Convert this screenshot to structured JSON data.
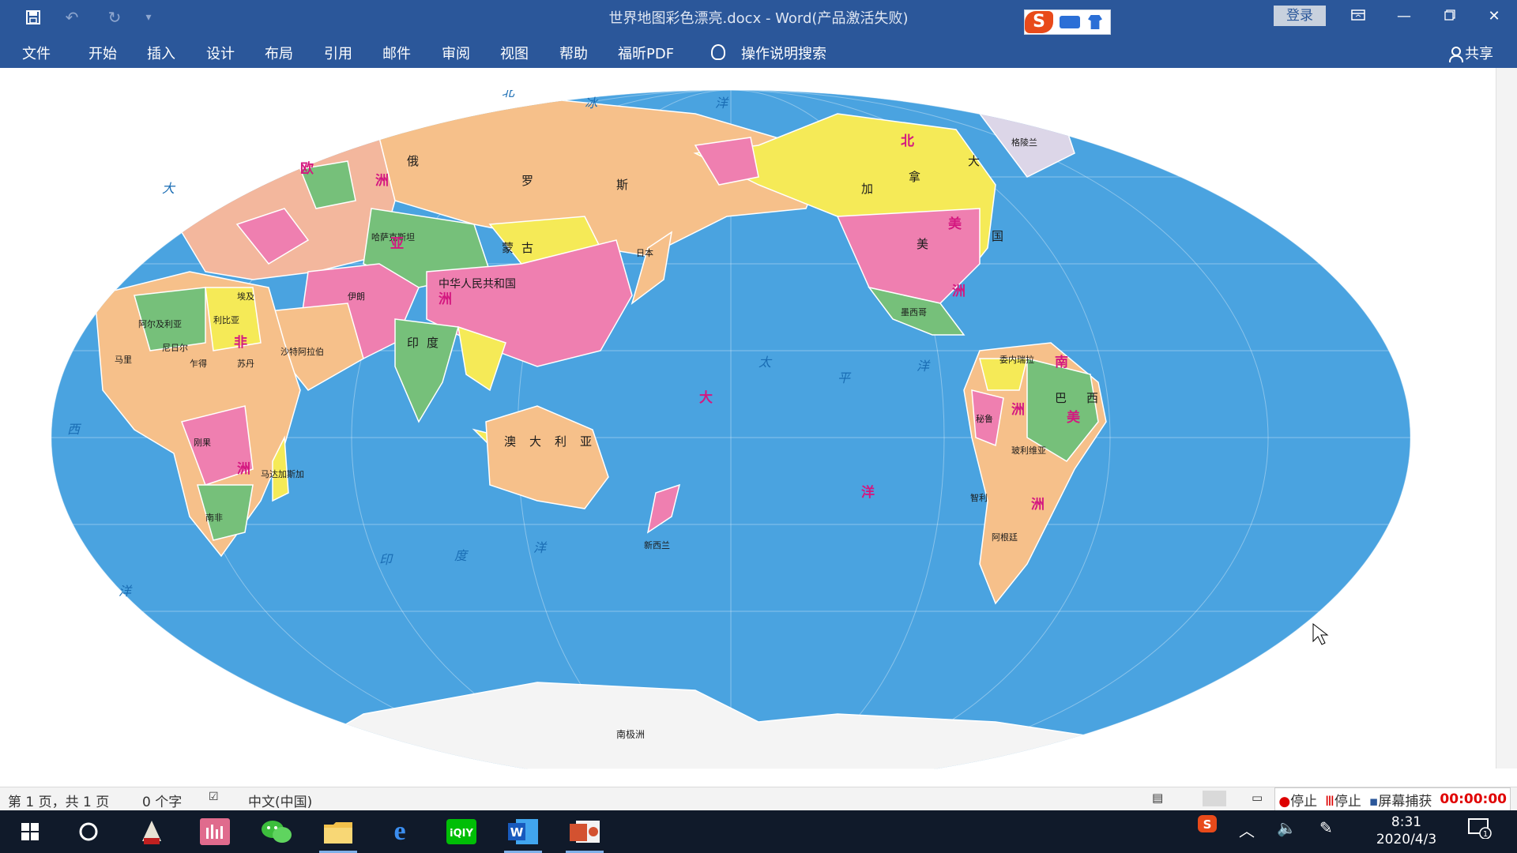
{
  "window": {
    "title": "世界地图彩色漂亮.docx  -  Word(产品激活失败)",
    "login_label": "登录",
    "controls": [
      "ribbon-display-icon",
      "minimize-icon",
      "restore-icon",
      "close-icon"
    ]
  },
  "quick_access": [
    "save-icon",
    "undo-icon",
    "redo-icon",
    "customize-icon"
  ],
  "ribbon": {
    "tabs": [
      "文件",
      "开始",
      "插入",
      "设计",
      "布局",
      "引用",
      "邮件",
      "审阅",
      "视图",
      "帮助",
      "福昕PDF"
    ],
    "search_label": "操作说明搜索",
    "share_label": "共享"
  },
  "map": {
    "continents": [
      "北",
      "美",
      "洲",
      "南",
      "美",
      "洲",
      "欧",
      "洲",
      "亚",
      "洲",
      "非",
      "洲",
      "大",
      "洋",
      "洲"
    ],
    "oceans": [
      "北",
      "冰",
      "洋",
      "太",
      "平",
      "洋",
      "印",
      "度",
      "洋",
      "大",
      "西",
      "洋"
    ],
    "countries": [
      "俄",
      "罗",
      "斯",
      "中华人民共和国",
      "蒙",
      "古",
      "印",
      "度",
      "加",
      "拿",
      "大",
      "美",
      "国",
      "巴",
      "西",
      "澳",
      "大",
      "利",
      "亚",
      "哈萨克斯坦",
      "阿尔及利亚",
      "沙特阿拉伯",
      "利比亚",
      "乍得",
      "苏丹",
      "伊朗",
      "格陵兰",
      "秘鲁",
      "阿根廷",
      "刚果",
      "埃及",
      "马里",
      "尼日尔",
      "南非",
      "新西兰",
      "日本",
      "墨西哥",
      "委内瑞拉",
      "玻利维亚",
      "智利",
      "马达加斯加",
      "南极洲"
    ]
  },
  "statusbar": {
    "page": "第 1 页，共 1 页",
    "words": "0 个字",
    "language": "中文(中国)",
    "rec_stop1": "停止",
    "rec_stop2": "停止",
    "rec_capture": "屏幕捕获",
    "rec_time": "00:00:00"
  },
  "taskbar": {
    "apps": [
      "windows-start-icon",
      "cortana-icon",
      "pdf-app-icon",
      "music-app-icon",
      "wechat-icon",
      "file-explorer-icon",
      "edge-icon",
      "iqiyi-icon",
      "word-icon",
      "powerpoint-icon"
    ],
    "time": "8:31",
    "date": "2020/4/3",
    "notification_count": "1"
  },
  "colors": {
    "word_blue": "#2b579a",
    "ocean": "#4aa3e0",
    "land_orange": "#f6c08a",
    "land_pink": "#ef7fb0",
    "land_yellow": "#f5ea57",
    "land_green": "#76c07a",
    "rec_time": "#e00000"
  }
}
